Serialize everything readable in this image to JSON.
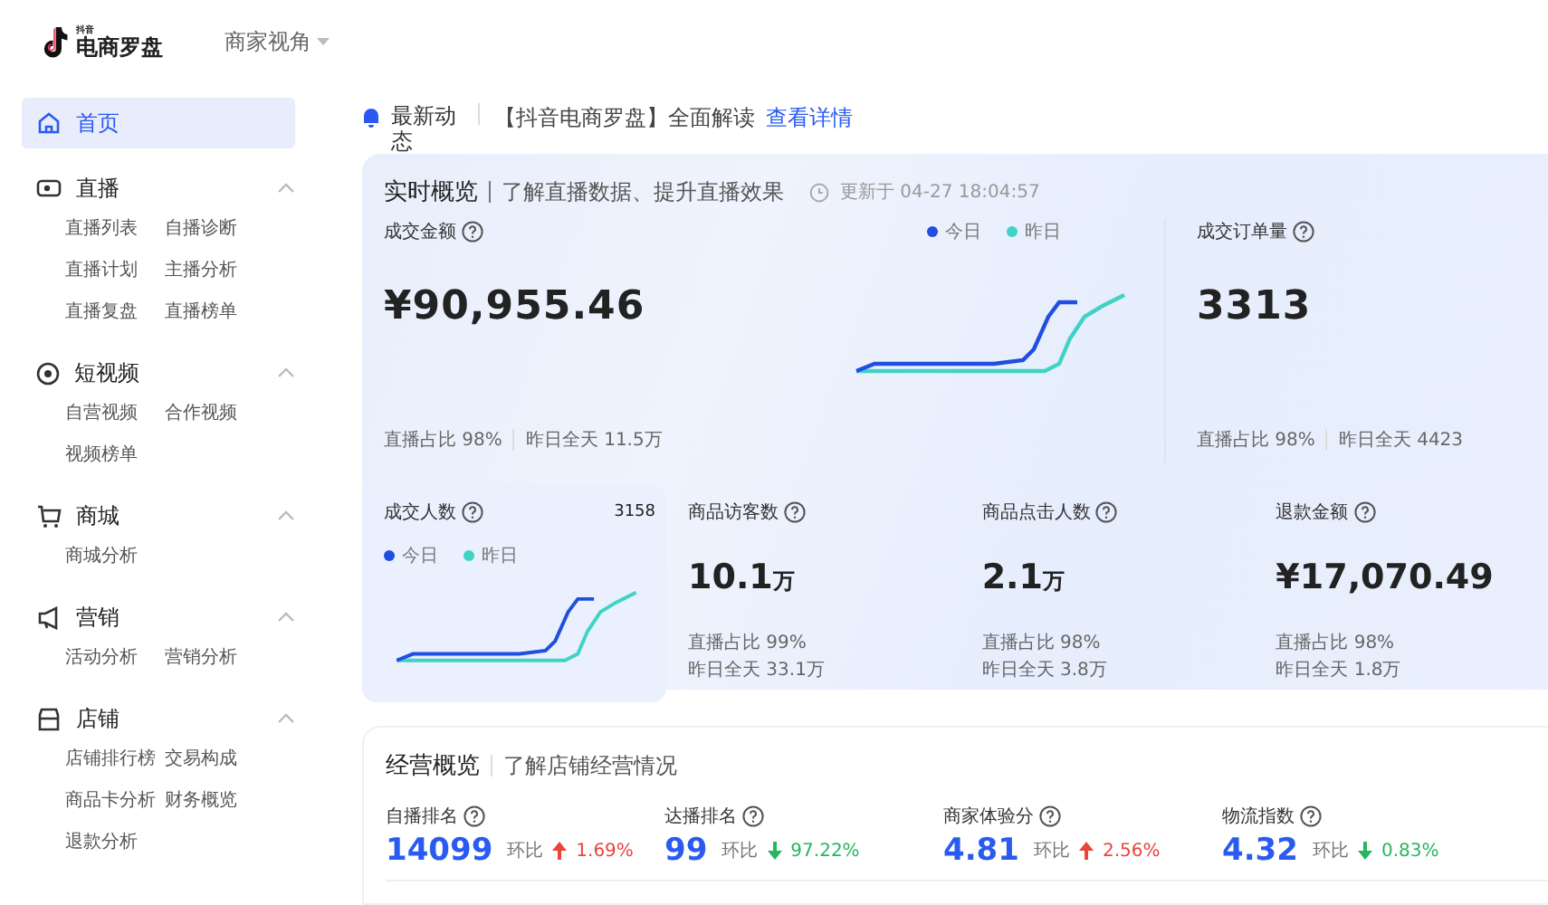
{
  "header": {
    "logo_small": "抖音",
    "logo": "电商罗盘",
    "view_switch": "商家视角"
  },
  "sidebar": {
    "home": {
      "label": "首页",
      "selected": true
    },
    "sections": [
      {
        "kind": "live",
        "title": "直播",
        "expanded": true,
        "items": [
          "直播列表",
          "自播诊断",
          "直播计划",
          "主播分析",
          "直播复盘",
          "直播榜单"
        ]
      },
      {
        "kind": "video",
        "title": "短视频",
        "expanded": true,
        "items": [
          "自营视频",
          "合作视频",
          "视频榜单"
        ]
      },
      {
        "kind": "cart",
        "title": "商城",
        "expanded": true,
        "items": [
          "商城分析"
        ]
      },
      {
        "kind": "megaphone",
        "title": "营销",
        "expanded": true,
        "items": [
          "活动分析",
          "营销分析"
        ]
      },
      {
        "kind": "shop",
        "title": "店铺",
        "expanded": true,
        "items": [
          "店铺排行榜",
          "交易构成",
          "商品卡分析",
          "财务概览",
          "退款分析"
        ]
      }
    ]
  },
  "notice": {
    "label": "最新动态",
    "text": "【抖音电商罗盘】全面解读",
    "link": "查看详情"
  },
  "realtime": {
    "title": "实时概览",
    "subtitle": "了解直播数据、提升直播效果",
    "updated": "更新于 04-27 18:04:57",
    "legend": [
      {
        "label": "今日",
        "color": "#1f4ee0"
      },
      {
        "label": "昨日",
        "color": "#3fd3c6"
      }
    ],
    "gmv": {
      "label": "成交金额",
      "value": "¥90,955.46",
      "share": "直播占比 98%",
      "yesterday": "昨日全天 11.5万"
    },
    "orders": {
      "label": "成交订单量",
      "value": "3313",
      "share": "直播占比 98%",
      "yesterday": "昨日全天 4423"
    },
    "buyers": {
      "label": "成交人数",
      "value": "3158",
      "legend": [
        {
          "label": "今日",
          "color": "#1f4ee0"
        },
        {
          "label": "昨日",
          "color": "#3fd3c6"
        }
      ]
    },
    "metrics": [
      {
        "label": "商品访客数",
        "value": "10.1",
        "unit": "万",
        "share": "直播占比 99%",
        "yesterday": "昨日全天 33.1万"
      },
      {
        "label": "商品点击人数",
        "value": "2.1",
        "unit": "万",
        "share": "直播占比 98%",
        "yesterday": "昨日全天 3.8万"
      },
      {
        "label": "退款金额",
        "value": "¥17,070.49",
        "share": "直播占比 98%",
        "yesterday": "昨日全天 1.8万"
      }
    ]
  },
  "business": {
    "title": "经营概览",
    "subtitle": "了解店铺经营情况",
    "metrics": [
      {
        "label": "自播排名",
        "value": "14099",
        "compare_label": "环比",
        "kind": "up",
        "change": "1.69%"
      },
      {
        "label": "达播排名",
        "value": "99",
        "compare_label": "环比",
        "kind": "down",
        "change": "97.22%"
      },
      {
        "label": "商家体验分",
        "value": "4.81",
        "compare_label": "环比",
        "kind": "up",
        "change": "2.56%"
      },
      {
        "label": "物流指数",
        "value": "4.32",
        "compare_label": "环比",
        "kind": "down",
        "change": "0.83%"
      }
    ]
  }
}
